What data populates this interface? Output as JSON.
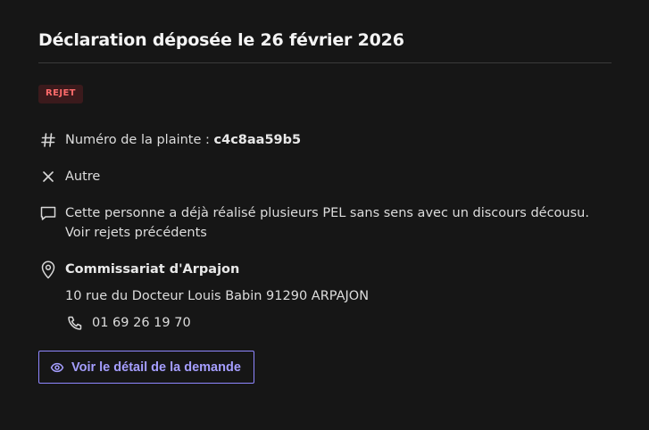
{
  "header": {
    "title": "Déclaration déposée le 26 février 2026"
  },
  "status": {
    "badge": "REJET",
    "color": "#ff6b6b",
    "background": "#3b1a1c"
  },
  "details": {
    "number_label": "Numéro de la plainte : ",
    "number_value": "c4c8aa59b5",
    "number_icon": "hash-icon",
    "type": "Autre",
    "type_icon": "close-icon",
    "comment": "Cette personne a déjà réalisé plusieurs PEL sans sens avec un discours décousu. Voir rejets précédents",
    "comment_icon": "message-icon",
    "place_name": "Commissariat d'Arpajon",
    "place_icon": "map-pin-icon",
    "address": "10 rue du Docteur Louis Babin 91290 ARPAJON",
    "phone": "01 69 26 19 70",
    "phone_icon": "phone-icon"
  },
  "actions": {
    "view_detail_label": "Voir le détail de la demande",
    "view_detail_icon": "eye-icon",
    "accent": "#a59eff"
  }
}
